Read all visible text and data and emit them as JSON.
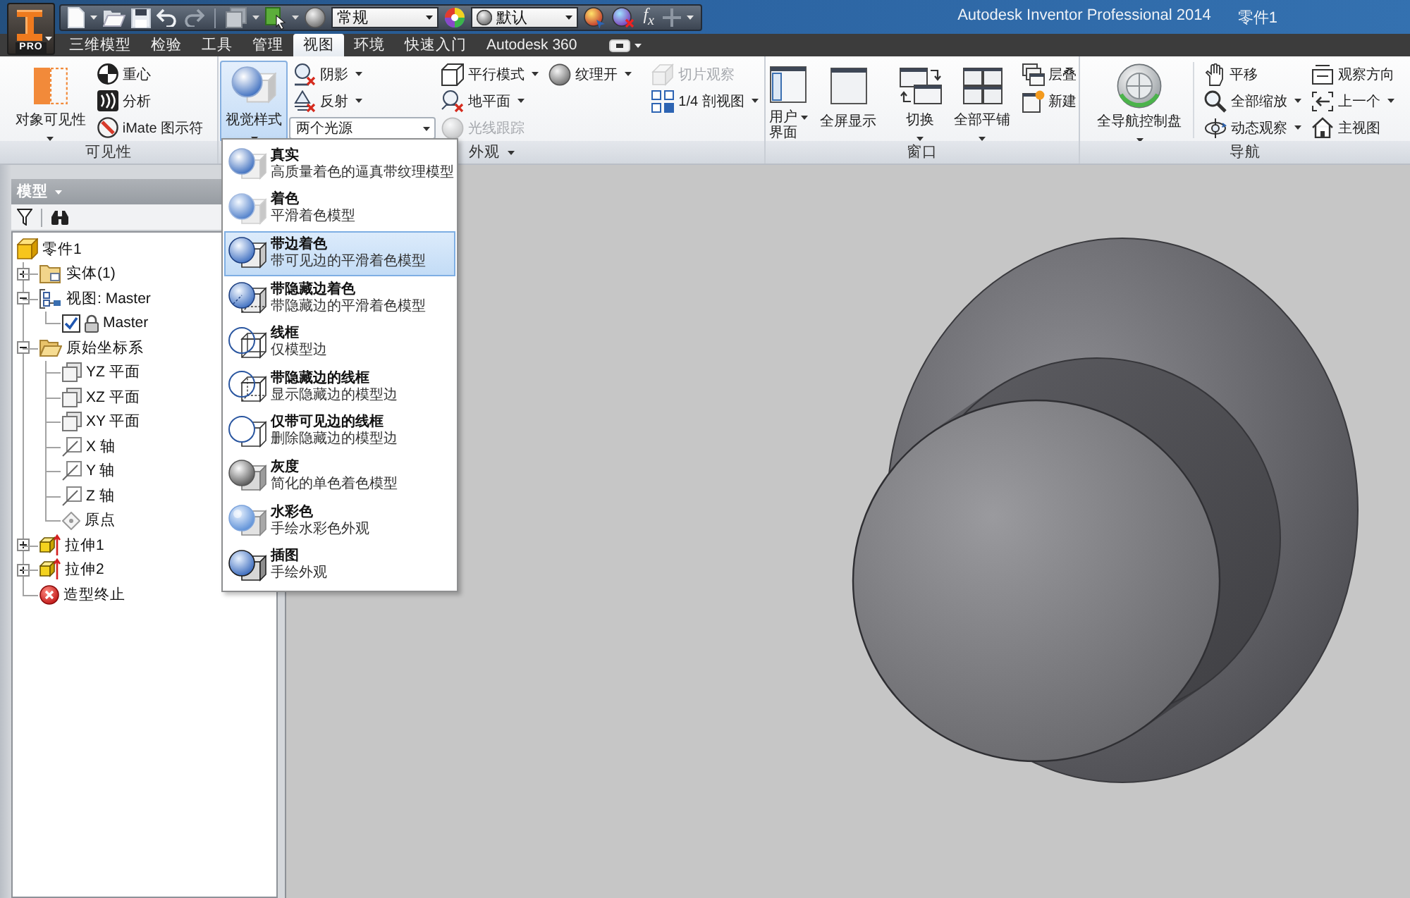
{
  "window": {
    "title": "Autodesk Inventor Professional 2014",
    "document": "零件1"
  },
  "app_button": {
    "badge": "PRO"
  },
  "quick_access": {
    "style_dropdown": "常规",
    "appearance_dropdown": "默认",
    "formula_glyph": "f$_{x}$"
  },
  "tabs": [
    {
      "label": "三维模型",
      "selected": false
    },
    {
      "label": "检验",
      "selected": false
    },
    {
      "label": "工具",
      "selected": false
    },
    {
      "label": "管理",
      "selected": false
    },
    {
      "label": "视图",
      "selected": true
    },
    {
      "label": "环境",
      "selected": false
    },
    {
      "label": "快速入门",
      "selected": false
    },
    {
      "label": "Autodesk 360",
      "selected": false
    }
  ],
  "ribbon": {
    "panels": [
      {
        "title": "可见性",
        "menu": false,
        "groups": [
          [
            [
              {
                "kind": "large",
                "label": "对象可见性",
                "menu": true,
                "disabled": false,
                "pressed": false
              }
            ],
            [
              {
                "kind": "small",
                "label": "重心",
                "menu": false,
                "disabled": false,
                "pressed": false
              },
              {
                "kind": "small",
                "label": "分析",
                "menu": false,
                "disabled": false,
                "pressed": false
              },
              {
                "kind": "small",
                "label": "iMate 图示符",
                "menu": false,
                "disabled": false,
                "pressed": false
              }
            ]
          ]
        ]
      },
      {
        "title": "外观",
        "menu": true,
        "groups": [
          [
            [
              {
                "kind": "large",
                "label": "视觉样式",
                "menu": true,
                "disabled": false,
                "pressed": true
              }
            ],
            [
              {
                "kind": "small",
                "label": "阴影",
                "menu": true,
                "disabled": false,
                "pressed": false
              },
              {
                "kind": "small",
                "label": "反射",
                "menu": true,
                "disabled": false,
                "pressed": false
              },
              {
                "kind": "dropdown",
                "value": "两个光源",
                "menu": true,
                "disabled": false,
                "pressed": false
              }
            ],
            [
              {
                "kind": "small",
                "label": "平行模式",
                "menu": true,
                "disabled": false,
                "pressed": false
              },
              {
                "kind": "small",
                "label": "地平面",
                "menu": true,
                "disabled": false,
                "pressed": false
              },
              {
                "kind": "small",
                "label": "光线跟踪",
                "menu": false,
                "disabled": true,
                "pressed": false
              }
            ],
            [
              {
                "kind": "small",
                "label": "纹理开",
                "menu": true,
                "disabled": false,
                "pressed": false
              }
            ]
          ],
          [
            [
              {
                "kind": "small",
                "label": "切片观察",
                "menu": false,
                "disabled": true,
                "pressed": false
              },
              {
                "kind": "small",
                "label": "1/4 剖视图",
                "menu": true,
                "disabled": false,
                "pressed": false
              }
            ]
          ]
        ]
      },
      {
        "title": "窗口",
        "menu": false,
        "groups": [
          [
            [
              {
                "kind": "large_narrow",
                "label": "用户界面",
                "menu": true,
                "disabled": false,
                "pressed": false
              }
            ],
            [
              {
                "kind": "large",
                "label": "全屏显示",
                "menu": false,
                "disabled": false,
                "pressed": false
              }
            ]
          ],
          [
            [
              {
                "kind": "large",
                "label": "切换",
                "menu": true,
                "disabled": false,
                "pressed": false
              }
            ],
            [
              {
                "kind": "large",
                "label": "全部平铺",
                "menu": true,
                "disabled": false,
                "pressed": false
              }
            ],
            [
              {
                "kind": "small",
                "label": "层叠",
                "menu": false,
                "disabled": false,
                "pressed": false
              },
              {
                "kind": "small",
                "label": "新建",
                "menu": false,
                "disabled": false,
                "pressed": false
              }
            ]
          ]
        ]
      },
      {
        "title": "导航",
        "menu": false,
        "groups": [
          [
            [
              {
                "kind": "large",
                "label": "全导航控制盘",
                "menu": true,
                "disabled": false,
                "pressed": false
              }
            ]
          ],
          [
            [
              {
                "kind": "small",
                "label": "平移",
                "menu": false,
                "disabled": false,
                "pressed": false
              },
              {
                "kind": "small",
                "label": "全部缩放",
                "menu": true,
                "disabled": false,
                "pressed": false
              },
              {
                "kind": "small",
                "label": "动态观察",
                "menu": true,
                "disabled": false,
                "pressed": false
              }
            ],
            [
              {
                "kind": "small",
                "label": "观察方向",
                "menu": false,
                "disabled": false,
                "pressed": false
              },
              {
                "kind": "small",
                "label": "上一个",
                "menu": true,
                "disabled": false,
                "pressed": false
              },
              {
                "kind": "small",
                "label": "主视图",
                "menu": false,
                "disabled": false,
                "pressed": false
              }
            ]
          ]
        ]
      }
    ]
  },
  "browser": {
    "title": "模型",
    "tree": [
      {
        "kind": "part",
        "label": "零件1",
        "children": [
          {
            "kind": "folder",
            "label": "实体(1)",
            "expanded": false
          },
          {
            "kind": "view",
            "label": "视图: Master",
            "expanded": true,
            "children": [
              {
                "kind": "view_rep",
                "label": "Master",
                "checked": true
              }
            ]
          },
          {
            "kind": "folder",
            "label": "原始坐标系",
            "expanded": true,
            "children": [
              {
                "kind": "plane",
                "label": "YZ 平面"
              },
              {
                "kind": "plane",
                "label": "XZ 平面"
              },
              {
                "kind": "plane",
                "label": "XY 平面"
              },
              {
                "kind": "axis",
                "label": "X 轴"
              },
              {
                "kind": "axis",
                "label": "Y 轴"
              },
              {
                "kind": "axis",
                "label": "Z 轴"
              },
              {
                "kind": "point",
                "label": "原点"
              }
            ]
          },
          {
            "kind": "feature",
            "label": "拉伸1",
            "expanded": false
          },
          {
            "kind": "feature",
            "label": "拉伸2",
            "expanded": false
          },
          {
            "kind": "end",
            "label": "造型终止"
          }
        ]
      }
    ]
  },
  "visual_style_menu": {
    "items": [
      {
        "kind": "realistic",
        "title": "真实",
        "description": "高质量着色的逼真带纹理模型",
        "selected": false
      },
      {
        "kind": "shaded",
        "title": "着色",
        "description": "平滑着色模型",
        "selected": false
      },
      {
        "kind": "shaded_edges",
        "title": "带边着色",
        "description": "带可见边的平滑着色模型",
        "selected": true
      },
      {
        "kind": "shaded_hidden_edges",
        "title": "带隐藏边着色",
        "description": "带隐藏边的平滑着色模型",
        "selected": false
      },
      {
        "kind": "wireframe",
        "title": "线框",
        "description": "仅模型边",
        "selected": false
      },
      {
        "kind": "wireframe_hidden",
        "title": "带隐藏边的线框",
        "description": "显示隐藏边的模型边",
        "selected": false
      },
      {
        "kind": "wireframe_visible",
        "title": "仅带可见边的线框",
        "description": "删除隐藏边的模型边",
        "selected": false
      },
      {
        "kind": "monochrome",
        "title": "灰度",
        "description": "简化的单色着色模型",
        "selected": false
      },
      {
        "kind": "watercolor",
        "title": "水彩色",
        "description": "手绘水彩色外观",
        "selected": false
      },
      {
        "kind": "illustration",
        "title": "插图",
        "description": "手绘外观",
        "selected": false
      }
    ]
  }
}
